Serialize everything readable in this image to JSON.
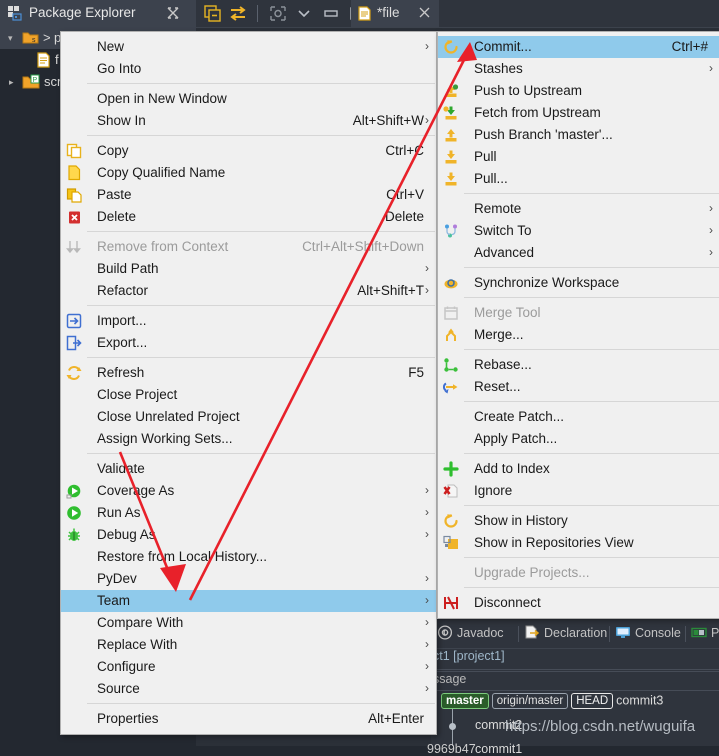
{
  "window": {
    "explorer_tab": "Package Explorer",
    "editor_tab": "*file",
    "tree": [
      {
        "label": "p",
        "kind": "project-folder",
        "selected": true,
        "expander": "▾"
      },
      {
        "label": "f",
        "kind": "file",
        "selected": false,
        "expander": ""
      },
      {
        "label": "scri",
        "kind": "source-folder",
        "selected": false,
        "expander": "▸"
      }
    ],
    "toolbar_icons": [
      "collapse-all-icon",
      "link-with-editor-icon",
      "focus-icon",
      "view-menu-chevron-icon",
      "minimize-icon",
      "maximize-icon"
    ]
  },
  "context_menu": {
    "items": [
      {
        "label": "New",
        "accel": "",
        "arrow": true,
        "icon": "",
        "disabled": false
      },
      {
        "label": "Go Into",
        "accel": "",
        "arrow": false,
        "icon": "",
        "disabled": false
      },
      {
        "sep": true
      },
      {
        "label": "Open in New Window",
        "accel": "",
        "arrow": false,
        "icon": "",
        "disabled": false
      },
      {
        "label": "Show In",
        "accel": "Alt+Shift+W",
        "arrow": true,
        "icon": "",
        "disabled": false
      },
      {
        "sep": true
      },
      {
        "label": "Copy",
        "accel": "Ctrl+C",
        "arrow": false,
        "icon": "copy-icon",
        "disabled": false
      },
      {
        "label": "Copy Qualified Name",
        "accel": "",
        "arrow": false,
        "icon": "copy-qualified-name-icon",
        "disabled": false
      },
      {
        "label": "Paste",
        "accel": "Ctrl+V",
        "arrow": false,
        "icon": "paste-icon",
        "disabled": false
      },
      {
        "label": "Delete",
        "accel": "Delete",
        "arrow": false,
        "icon": "delete-icon",
        "disabled": false
      },
      {
        "sep": true
      },
      {
        "label": "Remove from Context",
        "accel": "Ctrl+Alt+Shift+Down",
        "arrow": false,
        "icon": "remove-from-context-icon",
        "disabled": true
      },
      {
        "label": "Build Path",
        "accel": "",
        "arrow": true,
        "icon": "",
        "disabled": false
      },
      {
        "label": "Refactor",
        "accel": "Alt+Shift+T",
        "arrow": true,
        "icon": "",
        "disabled": false
      },
      {
        "sep": true
      },
      {
        "label": "Import...",
        "accel": "",
        "arrow": false,
        "icon": "import-icon",
        "disabled": false
      },
      {
        "label": "Export...",
        "accel": "",
        "arrow": false,
        "icon": "export-icon",
        "disabled": false
      },
      {
        "sep": true
      },
      {
        "label": "Refresh",
        "accel": "F5",
        "arrow": false,
        "icon": "refresh-icon",
        "disabled": false
      },
      {
        "label": "Close Project",
        "accel": "",
        "arrow": false,
        "icon": "",
        "disabled": false
      },
      {
        "label": "Close Unrelated Project",
        "accel": "",
        "arrow": false,
        "icon": "",
        "disabled": false
      },
      {
        "label": "Assign Working Sets...",
        "accel": "",
        "arrow": false,
        "icon": "",
        "disabled": false
      },
      {
        "sep": true
      },
      {
        "label": "Validate",
        "accel": "",
        "arrow": false,
        "icon": "",
        "disabled": false
      },
      {
        "label": "Coverage As",
        "accel": "",
        "arrow": true,
        "icon": "coverage-as-icon",
        "disabled": false
      },
      {
        "label": "Run As",
        "accel": "",
        "arrow": true,
        "icon": "run-as-icon",
        "disabled": false
      },
      {
        "label": "Debug As",
        "accel": "",
        "arrow": true,
        "icon": "debug-as-icon",
        "disabled": false
      },
      {
        "label": "Restore from Local History...",
        "accel": "",
        "arrow": false,
        "icon": "",
        "disabled": false
      },
      {
        "label": "PyDev",
        "accel": "",
        "arrow": true,
        "icon": "",
        "disabled": false
      },
      {
        "label": "Team",
        "accel": "",
        "arrow": true,
        "icon": "",
        "disabled": false,
        "highlighted": true
      },
      {
        "label": "Compare With",
        "accel": "",
        "arrow": true,
        "icon": "",
        "disabled": false
      },
      {
        "label": "Replace With",
        "accel": "",
        "arrow": true,
        "icon": "",
        "disabled": false
      },
      {
        "label": "Configure",
        "accel": "",
        "arrow": true,
        "icon": "",
        "disabled": false
      },
      {
        "label": "Source",
        "accel": "",
        "arrow": true,
        "icon": "",
        "disabled": false
      },
      {
        "sep": true
      },
      {
        "label": "Properties",
        "accel": "Alt+Enter",
        "arrow": false,
        "icon": "",
        "disabled": false
      }
    ]
  },
  "team_submenu": {
    "items": [
      {
        "label": "Commit...",
        "accel": "Ctrl+#",
        "arrow": false,
        "icon": "commit-icon",
        "disabled": false,
        "highlighted": true
      },
      {
        "label": "Stashes",
        "accel": "",
        "arrow": true,
        "icon": "",
        "disabled": false
      },
      {
        "label": "Push to Upstream",
        "accel": "",
        "arrow": false,
        "icon": "push-upstream-icon",
        "disabled": false
      },
      {
        "label": "Fetch from Upstream",
        "accel": "",
        "arrow": false,
        "icon": "fetch-upstream-icon",
        "disabled": false
      },
      {
        "label": "Push Branch 'master'...",
        "accel": "",
        "arrow": false,
        "icon": "push-branch-icon",
        "disabled": false
      },
      {
        "label": "Pull",
        "accel": "",
        "arrow": false,
        "icon": "pull-icon",
        "disabled": false
      },
      {
        "label": "Pull...",
        "accel": "",
        "arrow": false,
        "icon": "pull-dialog-icon",
        "disabled": false
      },
      {
        "sep": true
      },
      {
        "label": "Remote",
        "accel": "",
        "arrow": true,
        "icon": "",
        "disabled": false
      },
      {
        "label": "Switch To",
        "accel": "",
        "arrow": true,
        "icon": "switch-to-icon",
        "disabled": false
      },
      {
        "label": "Advanced",
        "accel": "",
        "arrow": true,
        "icon": "",
        "disabled": false
      },
      {
        "sep": true
      },
      {
        "label": "Synchronize Workspace",
        "accel": "",
        "arrow": false,
        "icon": "synchronize-icon",
        "disabled": false
      },
      {
        "sep": true
      },
      {
        "label": "Merge Tool",
        "accel": "",
        "arrow": false,
        "icon": "merge-tool-icon",
        "disabled": true
      },
      {
        "label": "Merge...",
        "accel": "",
        "arrow": false,
        "icon": "merge-icon",
        "disabled": false
      },
      {
        "sep": true
      },
      {
        "label": "Rebase...",
        "accel": "",
        "arrow": false,
        "icon": "rebase-icon",
        "disabled": false
      },
      {
        "label": "Reset...",
        "accel": "",
        "arrow": false,
        "icon": "reset-icon",
        "disabled": false
      },
      {
        "sep": true
      },
      {
        "label": "Create Patch...",
        "accel": "",
        "arrow": false,
        "icon": "",
        "disabled": false
      },
      {
        "label": "Apply Patch...",
        "accel": "",
        "arrow": false,
        "icon": "",
        "disabled": false
      },
      {
        "sep": true
      },
      {
        "label": "Add to Index",
        "accel": "",
        "arrow": false,
        "icon": "add-to-index-icon",
        "disabled": false
      },
      {
        "label": "Ignore",
        "accel": "",
        "arrow": false,
        "icon": "ignore-icon",
        "disabled": false
      },
      {
        "sep": true
      },
      {
        "label": "Show in History",
        "accel": "",
        "arrow": false,
        "icon": "show-in-history-icon",
        "disabled": false
      },
      {
        "label": "Show in Repositories View",
        "accel": "",
        "arrow": false,
        "icon": "show-in-repositories-icon",
        "disabled": false
      },
      {
        "sep": true
      },
      {
        "label": "Upgrade Projects...",
        "accel": "",
        "arrow": false,
        "icon": "",
        "disabled": true
      },
      {
        "sep": true
      },
      {
        "label": "Disconnect",
        "accel": "",
        "arrow": false,
        "icon": "disconnect-icon",
        "disabled": false
      }
    ]
  },
  "bottom_view": {
    "tabs": [
      {
        "label": "Javadoc",
        "icon": "javadoc-icon"
      },
      {
        "label": "Declaration",
        "icon": "declaration-icon"
      },
      {
        "label": "Console",
        "icon": "console-icon"
      },
      {
        "label": "Pr",
        "icon": "progress-icon"
      }
    ],
    "path": "ct1 [project1]",
    "column_header": "ssage",
    "commits": [
      {
        "message": "commit3",
        "refs": [
          "master",
          "origin/master",
          "HEAD"
        ]
      },
      {
        "message": "commit2",
        "refs": []
      },
      {
        "message": "commit1",
        "refs": []
      }
    ],
    "hash": "9969b47",
    "watermark": "https://blog.csdn.net/wuguifa"
  },
  "colors": {
    "menu_bg": "#f0f0f0",
    "menu_highlight": "#8fcaeb",
    "ide_bg": "#2f343d",
    "tree_bg": "#232830",
    "annotation_red": "#e8212a",
    "master_tag": "#2a5c2a"
  }
}
